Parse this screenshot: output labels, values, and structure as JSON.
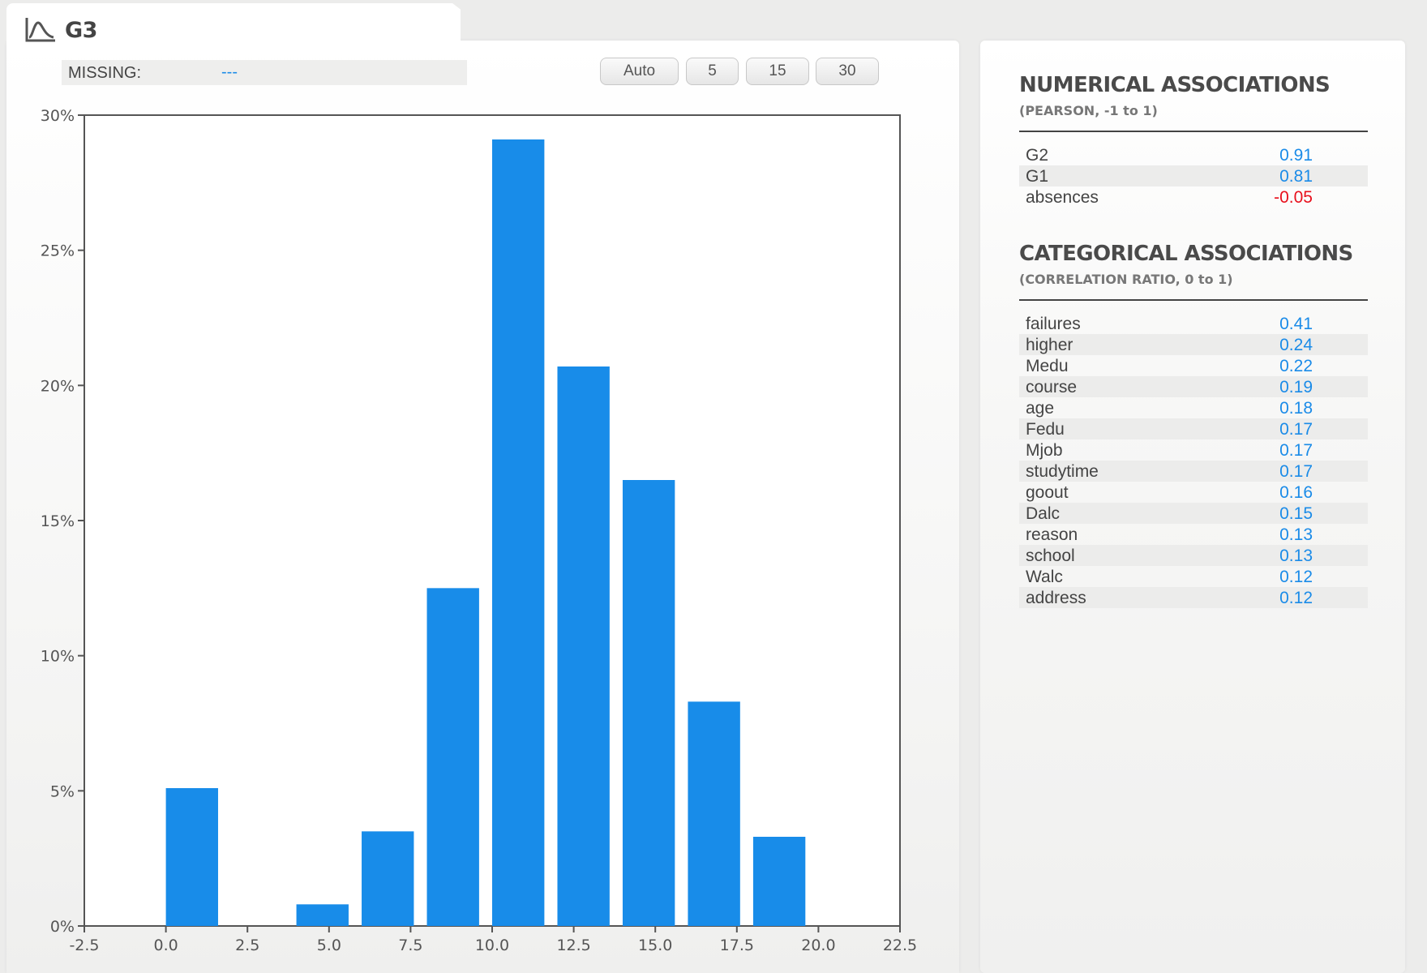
{
  "header": {
    "title": "G3",
    "icon": "distribution-curve-icon",
    "missing_label": "MISSING:",
    "missing_value": "---"
  },
  "bin_buttons": [
    "Auto",
    "5",
    "15",
    "30"
  ],
  "colors": {
    "bar": "#188ce9",
    "positive_value": "#1a8be8",
    "negative_value": "#e8101c"
  },
  "chart_data": {
    "type": "bar",
    "title": "",
    "xlabel": "",
    "ylabel": "",
    "xlim": [
      -2.5,
      22.5
    ],
    "ylim": [
      0,
      30
    ],
    "x_ticks": [
      "-2.5",
      "0.0",
      "2.5",
      "5.0",
      "7.5",
      "10.0",
      "12.5",
      "15.0",
      "17.5",
      "20.0",
      "22.5"
    ],
    "y_ticks": [
      "0%",
      "5%",
      "10%",
      "15%",
      "20%",
      "25%",
      "30%"
    ],
    "bin_width": 2,
    "bins": [
      {
        "start": 0,
        "end": 1.6,
        "value": 5.1
      },
      {
        "start": 4,
        "end": 5.6,
        "value": 0.8
      },
      {
        "start": 6,
        "end": 7.6,
        "value": 3.5
      },
      {
        "start": 8,
        "end": 9.6,
        "value": 12.5
      },
      {
        "start": 10,
        "end": 11.6,
        "value": 29.1
      },
      {
        "start": 12,
        "end": 13.6,
        "value": 20.7
      },
      {
        "start": 14,
        "end": 15.6,
        "value": 16.5
      },
      {
        "start": 16,
        "end": 17.6,
        "value": 8.3
      },
      {
        "start": 18,
        "end": 19.6,
        "value": 3.3
      }
    ]
  },
  "numerical": {
    "title": "NUMERICAL ASSOCIATIONS",
    "subtitle": "(PEARSON, -1 to 1)",
    "rows": [
      {
        "name": "G2",
        "value": "0.91",
        "negative": false
      },
      {
        "name": "G1",
        "value": "0.81",
        "negative": false
      },
      {
        "name": "absences",
        "value": "-0.05",
        "negative": true
      }
    ]
  },
  "categorical": {
    "title": "CATEGORICAL ASSOCIATIONS",
    "subtitle": "(CORRELATION RATIO, 0 to 1)",
    "rows": [
      {
        "name": "failures",
        "value": "0.41"
      },
      {
        "name": "higher",
        "value": "0.24"
      },
      {
        "name": "Medu",
        "value": "0.22"
      },
      {
        "name": "course",
        "value": "0.19"
      },
      {
        "name": "age",
        "value": "0.18"
      },
      {
        "name": "Fedu",
        "value": "0.17"
      },
      {
        "name": "Mjob",
        "value": "0.17"
      },
      {
        "name": "studytime",
        "value": "0.17"
      },
      {
        "name": "goout",
        "value": "0.16"
      },
      {
        "name": "Dalc",
        "value": "0.15"
      },
      {
        "name": "reason",
        "value": "0.13"
      },
      {
        "name": "school",
        "value": "0.13"
      },
      {
        "name": "Walc",
        "value": "0.12"
      },
      {
        "name": "address",
        "value": "0.12"
      }
    ]
  }
}
